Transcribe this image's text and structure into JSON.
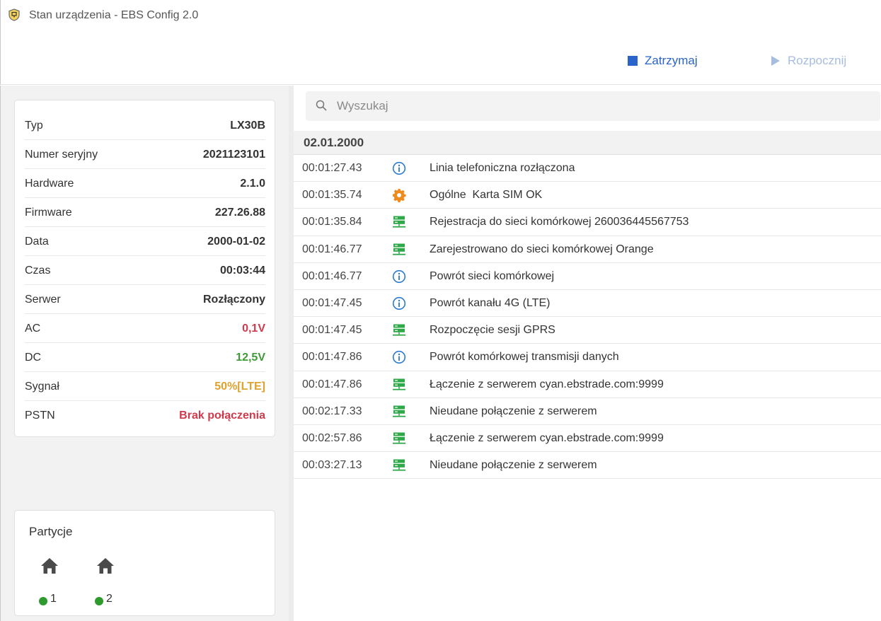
{
  "window": {
    "title": "Stan urządzenia - EBS Config 2.0"
  },
  "toolbar": {
    "stop_label": "Zatrzymaj",
    "start_label": "Rozpocznij"
  },
  "device_info": [
    {
      "key": "Typ",
      "value": "LX30B",
      "status": "normal"
    },
    {
      "key": "Numer seryjny",
      "value": "2021123101",
      "status": "normal"
    },
    {
      "key": "Hardware",
      "value": "2.1.0",
      "status": "normal"
    },
    {
      "key": "Firmware",
      "value": "227.26.88",
      "status": "normal"
    },
    {
      "key": "Data",
      "value": "2000-01-02",
      "status": "normal"
    },
    {
      "key": "Czas",
      "value": "00:03:44",
      "status": "normal"
    },
    {
      "key": "Serwer",
      "value": "Rozłączony",
      "status": "normal"
    },
    {
      "key": "AC",
      "value": "0,1V",
      "status": "red"
    },
    {
      "key": "DC",
      "value": "12,5V",
      "status": "green"
    },
    {
      "key": "Sygnał",
      "value": "50%[LTE]",
      "status": "orange"
    },
    {
      "key": "PSTN",
      "value": "Brak połączenia",
      "status": "red"
    }
  ],
  "partitions": {
    "title": "Partycje",
    "items": [
      {
        "label": "1",
        "status_color": "#2e9a2e",
        "icon": "home-icon"
      },
      {
        "label": "2",
        "status_color": "#2e9a2e",
        "icon": "home-icon"
      }
    ]
  },
  "search": {
    "placeholder": "Wyszukaj",
    "value": ""
  },
  "log": {
    "date": "02.01.2000",
    "entries": [
      {
        "time": "00:01:27.43",
        "icon": "info-icon",
        "message": "Linia telefoniczna rozłączona"
      },
      {
        "time": "00:01:35.74",
        "icon": "gear-icon",
        "message": "Ogólne  Karta SIM OK"
      },
      {
        "time": "00:01:35.84",
        "icon": "network-icon",
        "message": "Rejestracja do sieci komórkowej 260036445567753"
      },
      {
        "time": "00:01:46.77",
        "icon": "network-icon",
        "message": "Zarejestrowano do sieci komórkowej Orange"
      },
      {
        "time": "00:01:46.77",
        "icon": "info-icon",
        "message": "Powrót sieci komórkowej"
      },
      {
        "time": "00:01:47.45",
        "icon": "info-icon",
        "message": "Powrót kanału 4G (LTE)"
      },
      {
        "time": "00:01:47.45",
        "icon": "network-icon",
        "message": "Rozpoczęcie sesji GPRS"
      },
      {
        "time": "00:01:47.86",
        "icon": "info-icon",
        "message": "Powrót komórkowej transmisji danych"
      },
      {
        "time": "00:01:47.86",
        "icon": "network-icon",
        "message": "Łączenie z serwerem cyan.ebstrade.com:9999"
      },
      {
        "time": "00:02:17.33",
        "icon": "network-icon",
        "message": "Nieudane połączenie z serwerem"
      },
      {
        "time": "00:02:57.86",
        "icon": "network-icon",
        "message": "Łączenie z serwerem cyan.ebstrade.com:9999"
      },
      {
        "time": "00:03:27.13",
        "icon": "network-icon",
        "message": "Nieudane połączenie z serwerem"
      }
    ]
  },
  "colors": {
    "accent": "#2a63c9",
    "disabled": "#a7bdde",
    "status_red": "#d03a4c",
    "status_green": "#3d9a35",
    "status_orange": "#e0a22e",
    "info_blue": "#2b7bd0",
    "gear_orange": "#f08a1c",
    "network_green": "#2fa84a"
  }
}
